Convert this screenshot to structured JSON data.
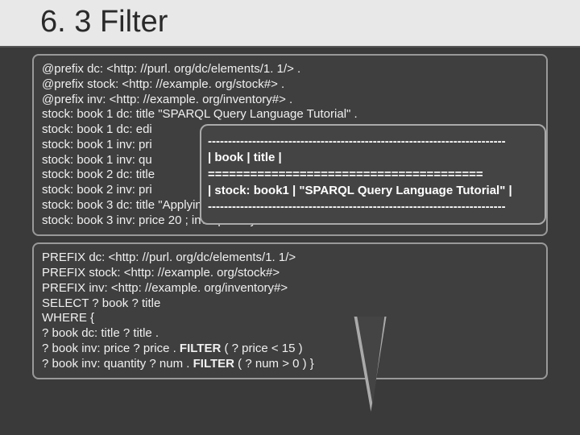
{
  "title": "6. 3 Filter",
  "data_block": {
    "l1": "@prefix dc: <http: //purl. org/dc/elements/1. 1/> .",
    "l2": "@prefix stock: <http: //example. org/stock#> .",
    "l3": "@prefix inv: <http: //example. org/inventory#> .",
    "l4": "stock: book 1 dc: title \"SPARQL Query Language Tutorial\" .",
    "l5": "stock: book 1 dc: edi",
    "l6": "stock: book 1 inv: pri",
    "l7": "stock: book 1 inv: qu",
    "l8": "stock: book 2 dc: title",
    "l9": "stock: book 2 inv: pri",
    "l10a": "stock: book 3 dc: title ",
    "l10b": "\"Applying XQuery\" ; dc: edition  3 .",
    "l11": "stock: book 3 inv: price 20 ; inv: quantity 8 ."
  },
  "result": {
    "r1": "--------------------------------------------------------------------------",
    "r2": "| book              | title                                                         |",
    "r3": "=======================================",
    "r4": "| stock: book1 | \"SPARQL Query Language Tutorial\" |",
    "r5": "--------------------------------------------------------------------------"
  },
  "query_block": {
    "q1": "PREFIX dc: <http: //purl. org/dc/elements/1. 1/>",
    "q2": "PREFIX stock: <http: //example. org/stock#>",
    "q3": "PREFIX inv: <http: //example. org/inventory#>",
    "q4": "SELECT ? book ? title",
    "q5": "WHERE {",
    "q6": "? book dc: title ? title .",
    "q7a": "? book inv: price ? price . ",
    "q7b": "FILTER",
    "q7c": " ( ? price < 15 )",
    "q8a": "? book inv: quantity ? num . ",
    "q8b": "FILTER",
    "q8c": " ( ? num > 0 ) }"
  }
}
